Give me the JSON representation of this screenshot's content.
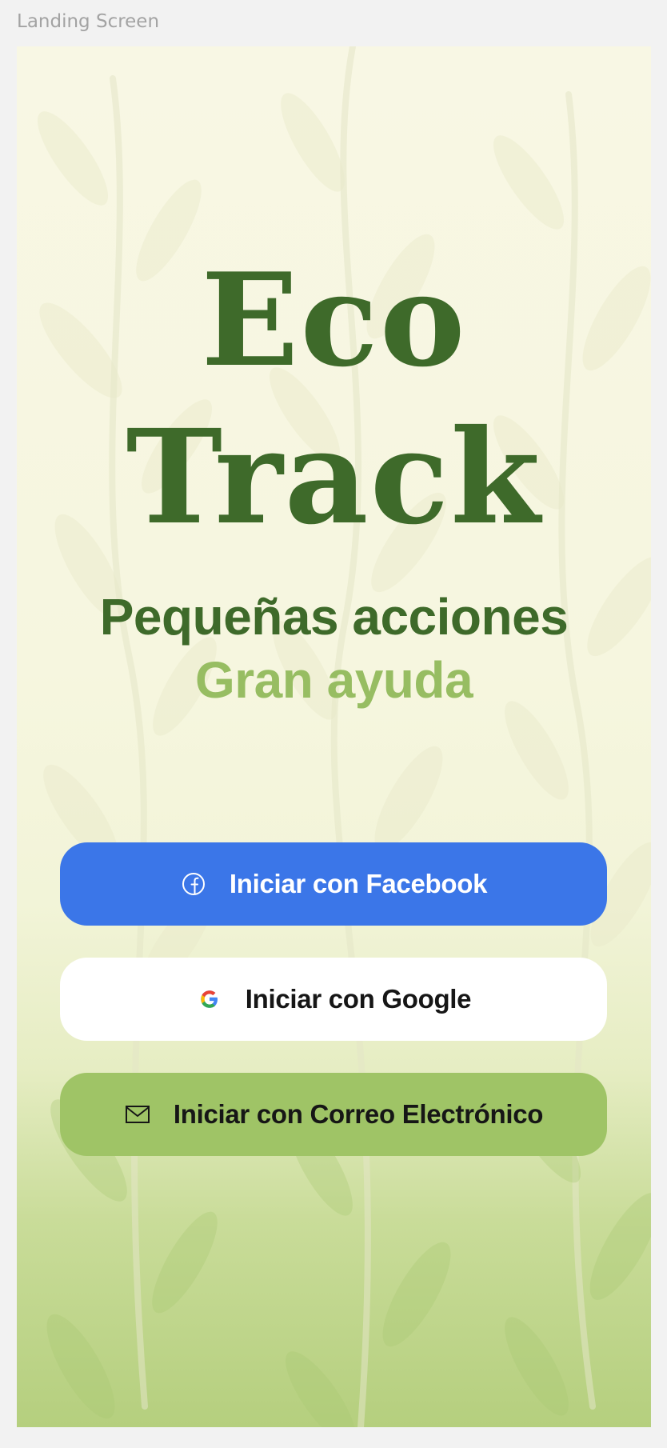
{
  "frame": {
    "label": "Landing Screen"
  },
  "brand": {
    "line1": "Eco",
    "line2": "Track"
  },
  "tagline": {
    "line1": "Pequeñas acciones",
    "line2": "Gran ayuda"
  },
  "auth": {
    "facebook": {
      "label": "Iniciar con Facebook",
      "icon": "facebook-icon"
    },
    "google": {
      "label": "Iniciar con Google",
      "icon": "google-icon"
    },
    "email": {
      "label": "Iniciar con Correo Electrónico",
      "icon": "mail-icon"
    }
  },
  "colors": {
    "brand_green": "#3e6a2a",
    "light_green": "#97bd62",
    "facebook_blue": "#3b76e8",
    "email_green": "#9fc466",
    "background": "#f8f7e4"
  }
}
